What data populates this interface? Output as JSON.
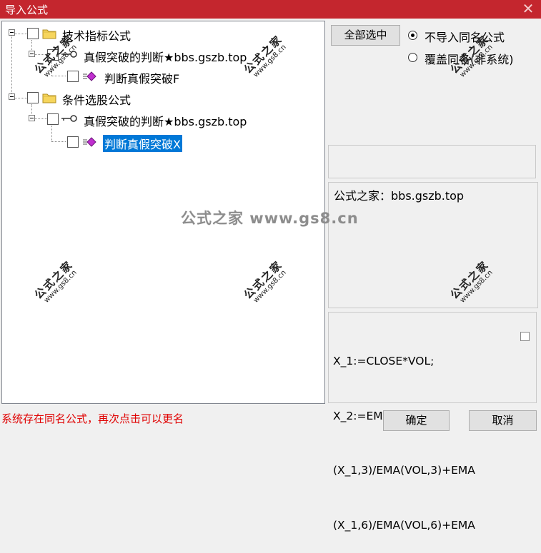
{
  "window": {
    "title": "导入公式",
    "close_glyph": "✕"
  },
  "tree": {
    "groups": [
      {
        "label": "技术指标公式",
        "child": {
          "label": "真假突破的判断★bbs.gszb.top",
          "leaf": "判断真假突破F"
        }
      },
      {
        "label": "条件选股公式",
        "child": {
          "label": "真假突破的判断★bbs.gszb.top",
          "leaf": "判断真假突破X"
        }
      }
    ]
  },
  "controls": {
    "select_all": "全部选中",
    "radio_no_import": "不导入同名公式",
    "radio_overwrite": "覆盖同名(非系统)"
  },
  "info": {
    "source": "公式之家：bbs.gszb.top"
  },
  "code": {
    "lines": [
      "X_1:=CLOSE*VOL;",
      "X_2:=EMA((EMA",
      "(X_1,3)/EMA(VOL,3)+EMA",
      "(X_1,6)/EMA(VOL,6)+EMA"
    ]
  },
  "status": "系统存在同名公式，再次点击可以更名",
  "buttons": {
    "ok": "确定",
    "cancel": "取消"
  },
  "watermark": {
    "name": "公式之家",
    "url": "www.gs8.cn",
    "center": "公式之家 www.gs8.cn"
  },
  "colors": {
    "titlebar": "#c4262e",
    "selection": "#0078d7",
    "status": "#e00000"
  }
}
